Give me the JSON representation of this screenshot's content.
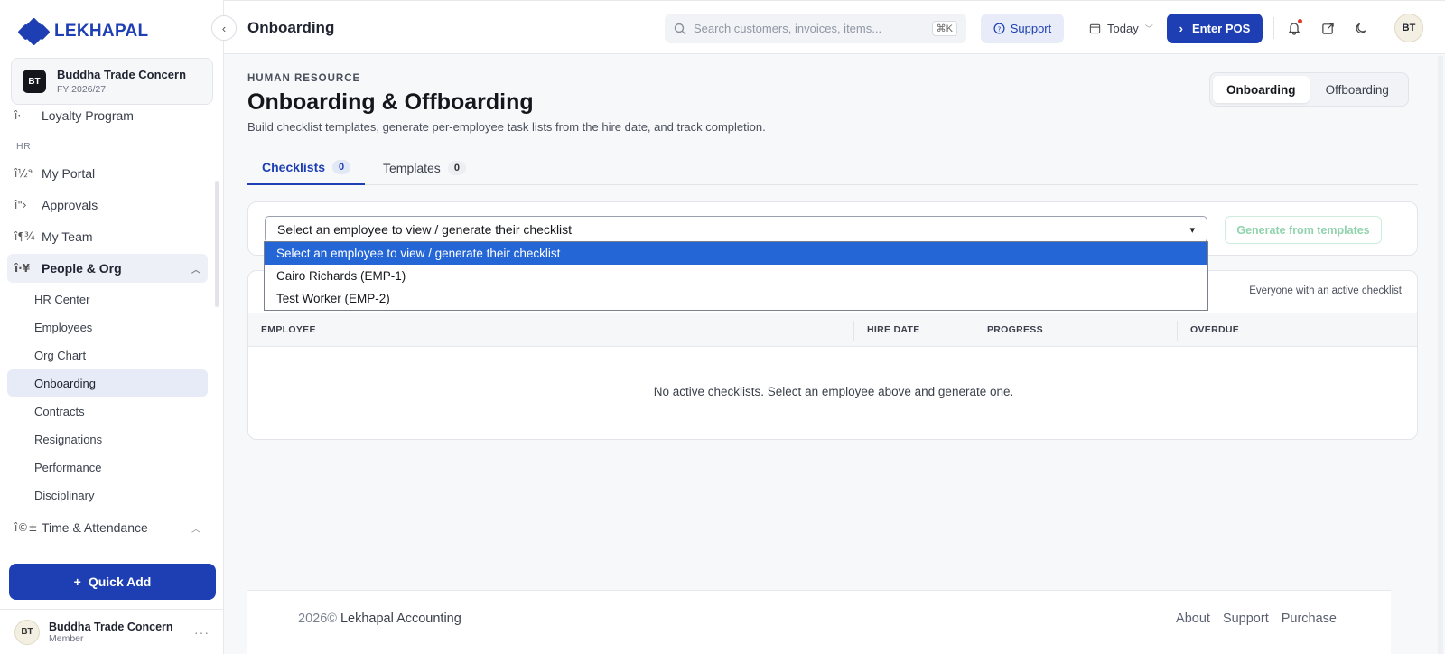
{
  "brand": {
    "name": "LEKHAPAL"
  },
  "company": {
    "initials": "BT",
    "name": "Buddha Trade Concern",
    "fy": "FY 2026/27"
  },
  "sidebar": {
    "cut_item": {
      "glyph": "î·",
      "label": "Loyalty Program"
    },
    "section_hr": "HR",
    "items": [
      {
        "glyph": "î½⁹",
        "label": "My Portal"
      },
      {
        "glyph": "î\"›",
        "label": "Approvals"
      },
      {
        "glyph": "î¶¾",
        "label": "My Team"
      },
      {
        "glyph": "î·¥",
        "label": "People & Org"
      }
    ],
    "sub_items": [
      "HR Center",
      "Employees",
      "Org Chart",
      "Onboarding",
      "Contracts",
      "Resignations",
      "Performance",
      "Disciplinary"
    ],
    "time_item": {
      "glyph": "î©±",
      "label": "Time & Attendance"
    },
    "quick_add": "Quick Add"
  },
  "user": {
    "initials": "BT",
    "name": "Buddha Trade Concern",
    "role": "Member"
  },
  "topbar": {
    "title": "Onboarding",
    "search_placeholder": "Search customers, invoices, items...",
    "search_shortcut": "⌘K",
    "support_label": "Support",
    "date_label": "Today",
    "enter_pos_label": "Enter POS",
    "avatar_initials": "BT"
  },
  "page": {
    "kicker": "HUMAN RESOURCE",
    "title": "Onboarding & Offboarding",
    "subtitle": "Build checklist templates, generate per-employee task lists from the hire date, and track completion.",
    "segment": {
      "options": [
        "Onboarding",
        "Offboarding"
      ],
      "active": "Onboarding"
    },
    "tabs": [
      {
        "label": "Checklists",
        "count": "0"
      },
      {
        "label": "Templates",
        "count": "0"
      }
    ],
    "employee_select": {
      "value": "Select an employee to view / generate their checklist",
      "options": [
        "Select an employee to view / generate their checklist",
        "Cairo Richards (EMP-1)",
        "Test Worker (EMP-2)"
      ]
    },
    "generate_label": "Generate from templates",
    "table_note": "Everyone with an active checklist",
    "columns": [
      "EMPLOYEE",
      "HIRE DATE",
      "PROGRESS",
      "OVERDUE"
    ],
    "empty_message": "No active checklists. Select an employee above and generate one."
  },
  "footer": {
    "year": "2026©",
    "company": "Lekhapal Accounting",
    "links": [
      "About",
      "Support",
      "Purchase"
    ]
  },
  "colors": {
    "brand": "#1d3fb3",
    "selected_option": "#2466d6",
    "generate_disabled": "#8fd3ad"
  }
}
